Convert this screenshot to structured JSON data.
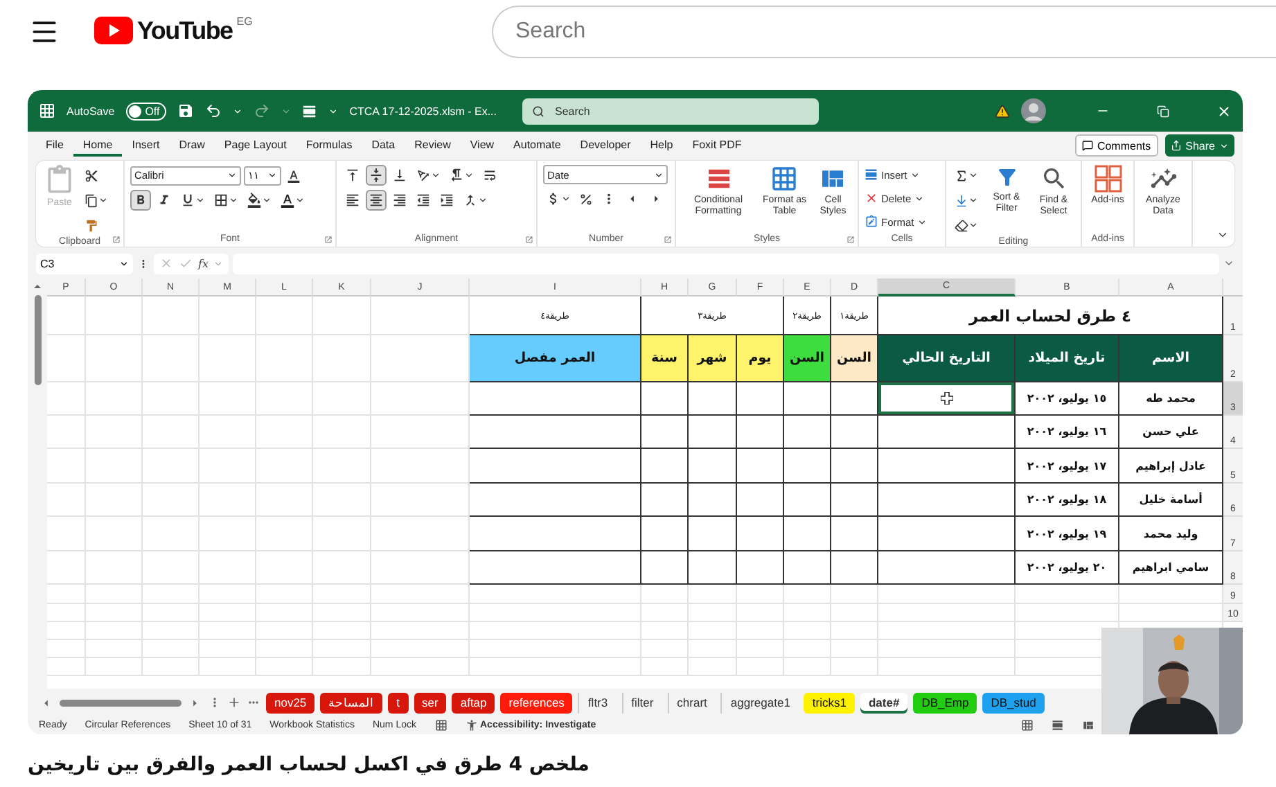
{
  "youtube": {
    "logo": "YouTube",
    "region": "EG",
    "search": {
      "placeholder": "Search"
    }
  },
  "excel": {
    "title_bar": {
      "autosave_label": "AutoSave",
      "autosave": {
        "label": "Off",
        "on": false
      },
      "file_name": "CTCA 17-12-2025.xlsm - Ex...",
      "search": {
        "placeholder": "Search"
      }
    },
    "tabs": [
      {
        "label": "File",
        "selected": false
      },
      {
        "label": "Home",
        "selected": true
      },
      {
        "label": "Insert",
        "selected": false
      },
      {
        "label": "Draw",
        "selected": false
      },
      {
        "label": "Page Layout",
        "selected": false
      },
      {
        "label": "Formulas",
        "selected": false
      },
      {
        "label": "Data",
        "selected": false
      },
      {
        "label": "Review",
        "selected": false
      },
      {
        "label": "View",
        "selected": false
      },
      {
        "label": "Automate",
        "selected": false
      },
      {
        "label": "Developer",
        "selected": false
      },
      {
        "label": "Help",
        "selected": false
      },
      {
        "label": "Foxit PDF",
        "selected": false
      }
    ],
    "comments": "Comments",
    "share": "Share",
    "ribbon": {
      "groups": [
        {
          "kind": "clipboard",
          "label": "Clipboard",
          "paste": {
            "label": "Paste",
            "disabled": true
          }
        },
        {
          "kind": "font",
          "label": "Font",
          "font_name": "Calibri",
          "font_size": "١١",
          "bold": true,
          "italic": false,
          "underline": false
        },
        {
          "kind": "alignment",
          "label": "Alignment",
          "align_top": false,
          "align_middle": true,
          "align_bottom": false,
          "align_left": false,
          "align_center": true,
          "align_right": false
        },
        {
          "kind": "number",
          "label": "Number",
          "format": "Date"
        },
        {
          "kind": "styles",
          "label": "Styles",
          "buttons": [
            "Conditional Formatting",
            "Format as Table",
            "Cell Styles"
          ]
        },
        {
          "kind": "cells",
          "label": "Cells",
          "buttons": [
            "Insert",
            "Delete",
            "Format"
          ]
        },
        {
          "kind": "editing",
          "label": "Editing",
          "buttons": [
            "Sort & Filter",
            "Find & Select"
          ]
        },
        {
          "kind": "addins",
          "label": "Add-ins",
          "buttons": [
            "Add-ins"
          ]
        },
        {
          "kind": "analyze",
          "buttons": [
            "Analyze Data"
          ]
        }
      ]
    },
    "formula_bar": {
      "name_box": "C3",
      "fx": "fx"
    },
    "sheet": {
      "columns": [
        {
          "label": "P",
          "selected": false
        },
        {
          "label": "O",
          "selected": false
        },
        {
          "label": "N",
          "selected": false
        },
        {
          "label": "M",
          "selected": false
        },
        {
          "label": "L",
          "selected": false
        },
        {
          "label": "K",
          "selected": false
        },
        {
          "label": "J",
          "selected": false
        },
        {
          "label": "I",
          "selected": false
        },
        {
          "label": "H",
          "selected": false
        },
        {
          "label": "G",
          "selected": false
        },
        {
          "label": "F",
          "selected": false
        },
        {
          "label": "E",
          "selected": false
        },
        {
          "label": "D",
          "selected": false
        },
        {
          "label": "C",
          "selected": true
        },
        {
          "label": "B",
          "selected": false
        },
        {
          "label": "A",
          "selected": false
        }
      ],
      "rows": [
        {
          "number": "1",
          "selected": false,
          "cells": [
            {
              "kind": "title",
              "text": "٤ طرق لحساب العمر"
            },
            {
              "kind": "merged"
            },
            {
              "kind": "merged"
            },
            {
              "kind": "caption",
              "text": "طريقة١"
            },
            {
              "kind": "caption",
              "text": "طريقة٢"
            },
            {
              "kind": "caption",
              "text": "طريقة٣"
            },
            {
              "kind": "merged"
            },
            {
              "kind": "merged"
            },
            {
              "kind": "caption",
              "text": "طريقة٤"
            }
          ]
        },
        {
          "number": "2",
          "selected": false,
          "cells": [
            {
              "text": "الاسم",
              "color": "#0b5a43"
            },
            {
              "text": "تاريخ الميلاد",
              "color": "#0b5a43"
            },
            {
              "text": "التاريخ الحالي",
              "color": "#0b5a43"
            },
            {
              "text": "السن",
              "color": "#fde9c6"
            },
            {
              "text": "السن",
              "color": "#3fdc3f"
            },
            {
              "text": "يوم",
              "color": "#fff36b"
            },
            {
              "text": "شهر",
              "color": "#fff36b"
            },
            {
              "text": "سنة",
              "color": "#fff36b"
            },
            {
              "text": "العمر مفصل",
              "color": "#66ccff"
            }
          ]
        },
        {
          "number": "3",
          "selected": true,
          "cells": [
            {
              "text": "محمد طه"
            },
            {
              "text": "١٥ يوليو، ٢٠٠٢"
            },
            {},
            {},
            {},
            {},
            {},
            {},
            {}
          ]
        },
        {
          "number": "4",
          "selected": false,
          "cells": [
            {
              "text": "علي حسن"
            },
            {
              "text": "١٦ يوليو، ٢٠٠٢"
            },
            {},
            {},
            {},
            {},
            {},
            {},
            {}
          ]
        },
        {
          "number": "5",
          "selected": false,
          "cells": [
            {
              "text": "عادل إبراهيم"
            },
            {
              "text": "١٧ يوليو، ٢٠٠٢"
            },
            {},
            {},
            {},
            {},
            {},
            {},
            {}
          ]
        },
        {
          "number": "6",
          "selected": false,
          "cells": [
            {
              "text": "أسامة خليل"
            },
            {
              "text": "١٨ يوليو، ٢٠٠٢"
            },
            {},
            {},
            {},
            {},
            {},
            {},
            {}
          ]
        },
        {
          "number": "7",
          "selected": false,
          "cells": [
            {
              "text": "وليد محمد"
            },
            {
              "text": "١٩ يوليو، ٢٠٠٢"
            },
            {},
            {},
            {},
            {},
            {},
            {},
            {}
          ]
        },
        {
          "number": "8",
          "selected": false,
          "cells": [
            {
              "text": "سامي ابراهيم"
            },
            {
              "text": "٢٠ يوليو، ٢٠٠٢"
            },
            {},
            {},
            {},
            {},
            {},
            {},
            {}
          ]
        },
        {
          "number": "9",
          "selected": false
        },
        {
          "number": "10",
          "selected": false
        }
      ]
    },
    "sheet_tabs": [
      {
        "label": "nov25",
        "color": "#d7170c",
        "selected": false
      },
      {
        "label": "المساحة",
        "color": "#d7170c",
        "selected": false
      },
      {
        "label": "t",
        "color": "#d7170c",
        "selected": false
      },
      {
        "label": "ser",
        "color": "#d7170c",
        "selected": false
      },
      {
        "label": "aftap",
        "color": "#d7170c",
        "selected": false
      },
      {
        "label": "references",
        "color": "#ff1a0a",
        "selected": false
      },
      {
        "label": "fltr3",
        "selected": false
      },
      {
        "label": "filter",
        "selected": false
      },
      {
        "label": "chrart",
        "selected": false
      },
      {
        "label": "aggregate1",
        "selected": false
      },
      {
        "label": "tricks1",
        "color": "#fff200",
        "selected": false
      },
      {
        "label": "date#",
        "selected": true
      },
      {
        "label": "DB_Emp",
        "color": "#22cc11",
        "selected": false
      },
      {
        "label": "DB_stud",
        "color": "#1ea2ef",
        "selected": false
      }
    ],
    "status_bar": [
      "Ready",
      "Circular References",
      "Sheet 10 of 31",
      "Workbook Statistics",
      "Num Lock"
    ],
    "accessibility": "Accessibility: Investigate"
  },
  "video_title": "ملخص 4 طرق في اكسل لحساب العمر والفرق بين تاريخين"
}
